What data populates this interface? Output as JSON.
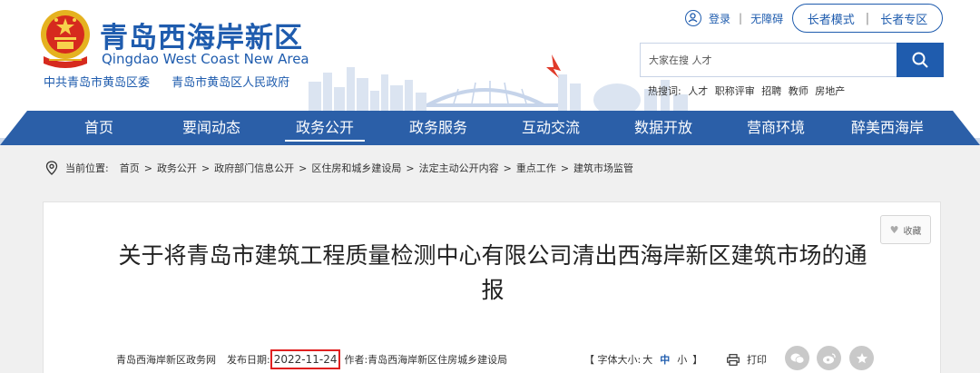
{
  "header": {
    "site_title": "青岛西海岸新区",
    "site_subtitle": "Qingdao West Coast New Area",
    "gov_links": [
      "中共青岛市黄岛区委",
      "青岛市黄岛区人民政府"
    ],
    "login": "登录",
    "accessibility": "无障碍",
    "elder_mode": "长者模式",
    "elder_zone": "长者专区",
    "search_placeholder": "大家在搜 人才",
    "hot_label": "热搜词:",
    "hot_words": [
      "人才",
      "职称评审",
      "招聘",
      "教师",
      "房地产"
    ]
  },
  "nav": {
    "items": [
      "首页",
      "要闻动态",
      "政务公开",
      "政务服务",
      "互动交流",
      "数据开放",
      "营商环境",
      "醉美西海岸"
    ],
    "active_index": 2
  },
  "breadcrumb": {
    "label": "当前位置:",
    "items": [
      "首页",
      "政务公开",
      "政府部门信息公开",
      "区住房和城乡建设局",
      "法定主动公开内容",
      "重点工作",
      "建筑市场监管"
    ]
  },
  "article": {
    "favorite": "收藏",
    "title": "关于将青岛市建筑工程质量检测中心有限公司清出西海岸新区建筑市场的通报",
    "source": "青岛西海岸新区政务网",
    "date_label": "发布日期:",
    "date": "2022-11-24",
    "author": "作者:青岛西海岸新区住房城乡建设局",
    "font_size_open": "【 字体大小:",
    "font_large": "大",
    "font_medium": "中",
    "font_small": "小",
    "font_size_close": "】",
    "print": "打印"
  },
  "colors": {
    "brand_blue": "#1f5cae",
    "nav_blue": "#2b5fa8",
    "highlight_red": "#e02020"
  }
}
